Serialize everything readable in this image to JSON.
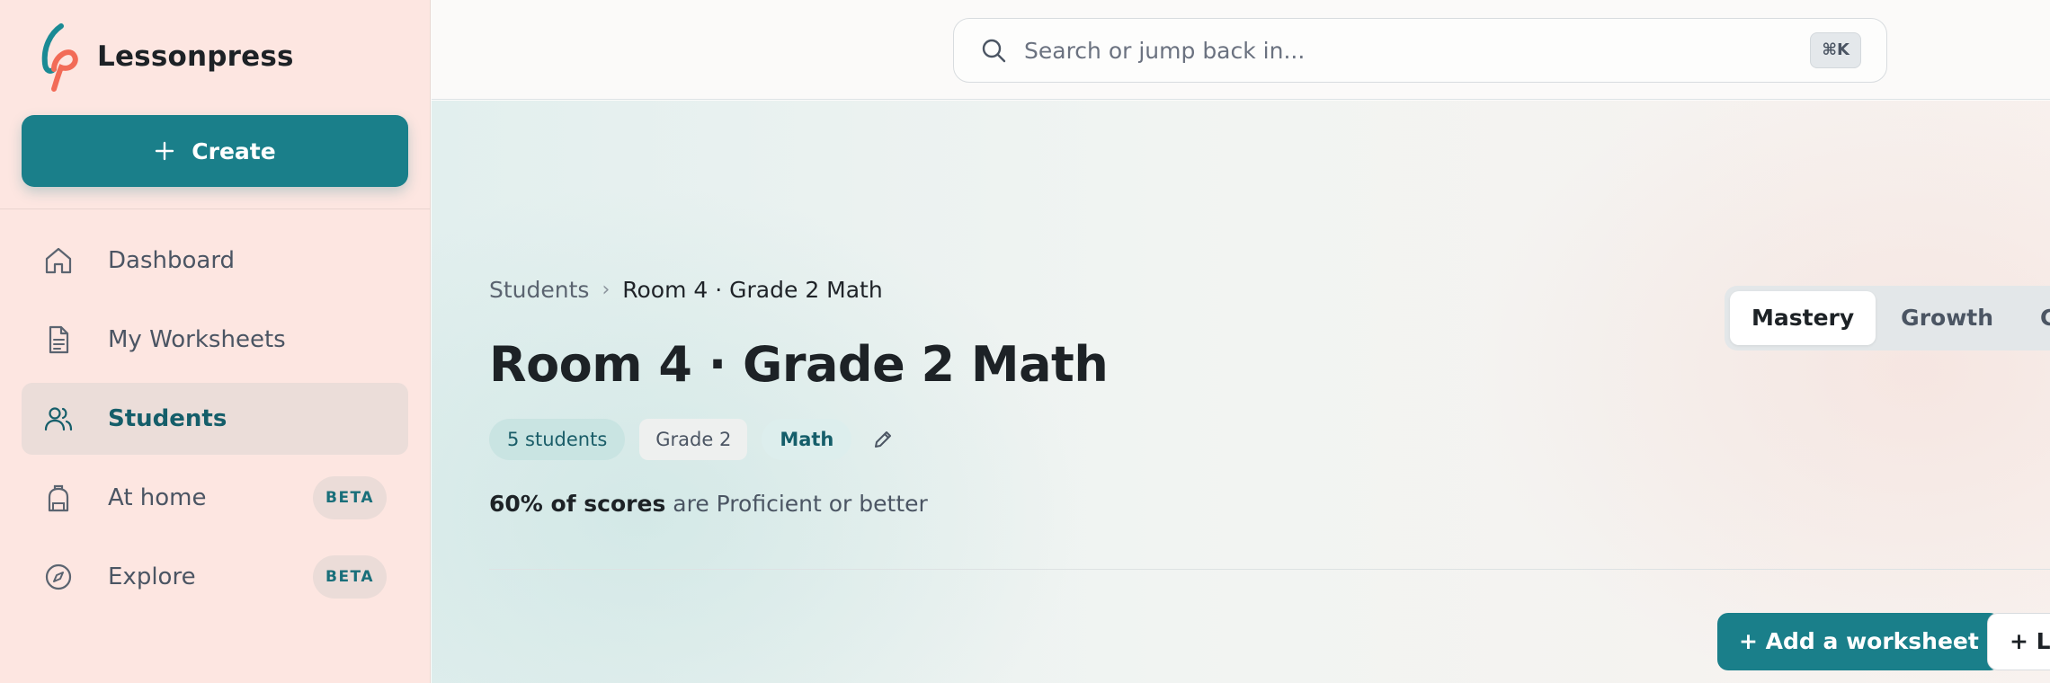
{
  "app": {
    "name": "Lessonpress",
    "brand_colors": {
      "teal": "#1a7f8a",
      "coral": "#f26b57",
      "sidebar_bg": "#fde6e1"
    }
  },
  "sidebar": {
    "create_label": "Create",
    "items": [
      {
        "label": "Dashboard",
        "icon": "home-icon",
        "active": false
      },
      {
        "label": "My Worksheets",
        "icon": "document-icon",
        "active": false
      },
      {
        "label": "Students",
        "icon": "users-icon",
        "active": true
      },
      {
        "label": "At home",
        "icon": "backpack-icon",
        "active": false,
        "badge": "BETA"
      },
      {
        "label": "Explore",
        "icon": "compass-icon",
        "active": false,
        "badge": "BETA"
      }
    ]
  },
  "search": {
    "placeholder": "Search or jump back in...",
    "shortcut": "⌘K"
  },
  "breadcrumb": {
    "root": "Students",
    "separator": "›",
    "current": "Room 4 · Grade 2 Math"
  },
  "page": {
    "title": "Room 4 · Grade 2 Math",
    "chips": {
      "students": "5 students",
      "grade": "Grade 2",
      "subject": "Math"
    },
    "summary": {
      "bold": "60% of scores",
      "rest": "are Proficient or better"
    }
  },
  "view_tabs": [
    {
      "label": "Mastery",
      "active": true
    },
    {
      "label": "Growth",
      "active": false
    },
    {
      "label": "Cov",
      "active": false
    }
  ],
  "actions": {
    "add_worksheet": "+ Add a worksheet",
    "second": "+ Lo"
  }
}
